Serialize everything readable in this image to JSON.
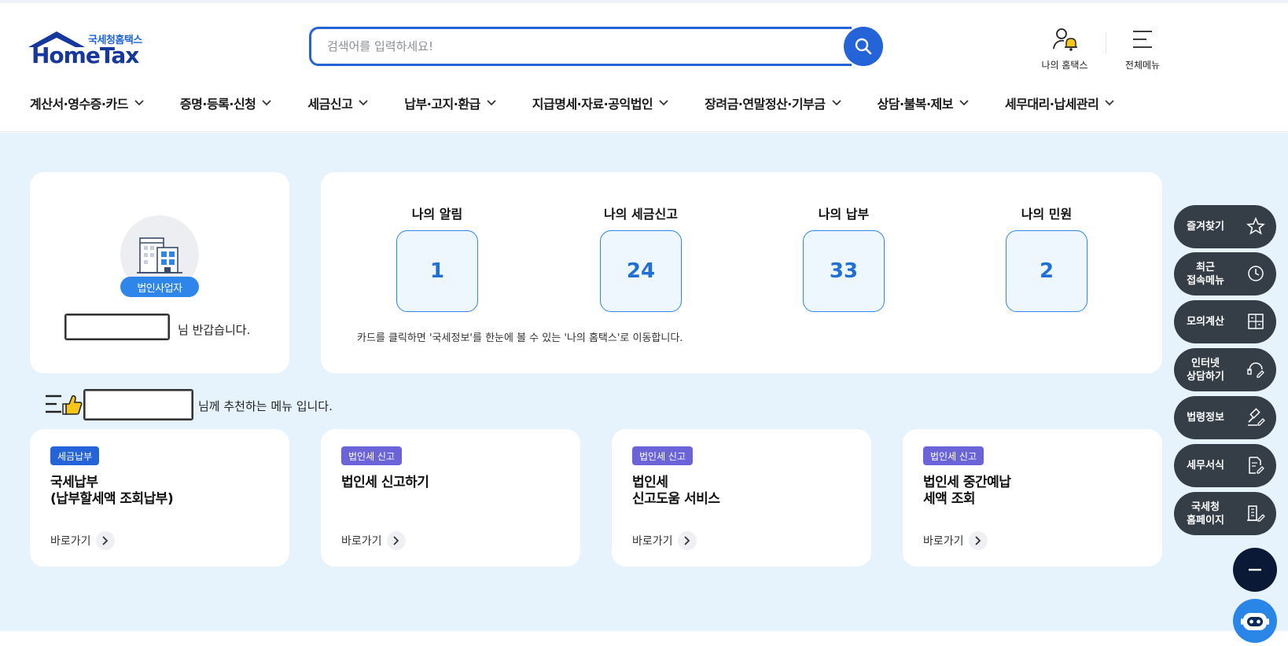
{
  "header": {
    "logo_sub": "국세청홈택스",
    "logo_main": "HomeTax",
    "search_placeholder": "검색어를 입력하세요!",
    "my_hometax_label": "나의 홈택스",
    "all_menu_label": "전체메뉴"
  },
  "nav": [
    {
      "label": "계산서·영수증·카드"
    },
    {
      "label": "증명·등록·신청"
    },
    {
      "label": "세금신고"
    },
    {
      "label": "납부·고지·환급"
    },
    {
      "label": "지급명세·자료·공익법인"
    },
    {
      "label": "장려금·연말정산·기부금"
    },
    {
      "label": "상담·불복·제보"
    },
    {
      "label": "세무대리·납세관리"
    }
  ],
  "profile": {
    "badge": "법인사업자",
    "greeting": "님 반갑습니다."
  },
  "summary": {
    "stats": [
      {
        "title": "나의 알림",
        "value": "1"
      },
      {
        "title": "나의 세금신고",
        "value": "24"
      },
      {
        "title": "나의 납부",
        "value": "33"
      },
      {
        "title": "나의 민원",
        "value": "2"
      }
    ],
    "note": "카드를 클릭하면 '국세정보'를 한눈에 볼 수 있는 '나의 홈택스'로 이동합니다."
  },
  "recommend": {
    "text": "님께 추천하는 메뉴 입니다."
  },
  "menu_cards": [
    {
      "tag": "세금납부",
      "tag_color": "#2563d9",
      "title_lines": [
        "국세납부",
        "(납부할세액 조회납부)"
      ],
      "goto": "바로가기"
    },
    {
      "tag": "법인세 신고",
      "tag_color": "#6b63d8",
      "title_lines": [
        "법인세 신고하기",
        ""
      ],
      "goto": "바로가기"
    },
    {
      "tag": "법인세 신고",
      "tag_color": "#6b63d8",
      "title_lines": [
        "법인세",
        "신고도움 서비스"
      ],
      "goto": "바로가기"
    },
    {
      "tag": "법인세 신고",
      "tag_color": "#6b63d8",
      "title_lines": [
        "법인세 중간예납",
        "세액 조회"
      ],
      "goto": "바로가기"
    }
  ],
  "quick_menu": [
    {
      "lines": [
        "즐겨찾기",
        ""
      ],
      "icon": "star-icon"
    },
    {
      "lines": [
        "최근",
        "접속메뉴"
      ],
      "icon": "clock-icon"
    },
    {
      "lines": [
        "모의계산",
        ""
      ],
      "icon": "calculator-icon"
    },
    {
      "lines": [
        "인터넷",
        "상담하기"
      ],
      "icon": "chat-icon"
    },
    {
      "lines": [
        "법령정보",
        ""
      ],
      "icon": "gavel-icon"
    },
    {
      "lines": [
        "세무서식",
        ""
      ],
      "icon": "document-icon"
    },
    {
      "lines": [
        "국세청",
        "홈페이지"
      ],
      "icon": "building-icon"
    }
  ],
  "colors": {
    "primary": "#2563d9",
    "logo_navy": "#16379b",
    "background": "#e7f3fc",
    "quick_menu_bg": "#353d46",
    "corp_badge": "#2e86ea"
  }
}
